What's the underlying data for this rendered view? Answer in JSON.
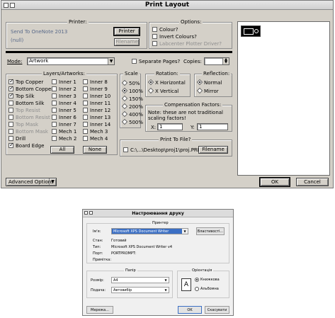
{
  "print_layout": {
    "title": "Print Layout",
    "printer": {
      "group_label": "Printer:",
      "name": "Send To OneNote 2013",
      "port": "(null)",
      "printer_button": "Printer",
      "filename_button": "Filename"
    },
    "options": {
      "group_label": "Options:",
      "colour": "Colour?",
      "invert": "Invert Colours?",
      "labcenter": "Labcenter Plotter Driver?"
    },
    "mode": {
      "label": "Mode:",
      "value": "Artwork",
      "separate_pages": "Separate Pages?",
      "copies_label": "Copies:"
    },
    "layers": {
      "group_label": "Layers/Artworks:",
      "col1": [
        {
          "label": "Top Copper",
          "checked": true,
          "disabled": false
        },
        {
          "label": "Bottom Copper",
          "checked": true,
          "disabled": false
        },
        {
          "label": "Top Silk",
          "checked": true,
          "disabled": false
        },
        {
          "label": "Bottom Silk",
          "checked": false,
          "disabled": false
        },
        {
          "label": "Top Resist",
          "checked": false,
          "disabled": true
        },
        {
          "label": "Bottom Resist",
          "checked": false,
          "disabled": true
        },
        {
          "label": "Top Mask",
          "checked": false,
          "disabled": true
        },
        {
          "label": "Bottom Mask",
          "checked": false,
          "disabled": true
        },
        {
          "label": "Drill",
          "checked": false,
          "disabled": false
        },
        {
          "label": "Board Edge",
          "checked": true,
          "disabled": false
        }
      ],
      "col2": [
        "Inner 1",
        "Inner 2",
        "Inner 3",
        "Inner 4",
        "Inner 5",
        "Inner 6",
        "Inner 7",
        "Mech 1",
        "Mech 2"
      ],
      "col3": [
        "Inner 8",
        "Inner 9",
        "Inner 10",
        "Inner 11",
        "Inner 12",
        "Inner 13",
        "Inner 14",
        "Mech 3",
        "Mech 4"
      ],
      "all_button": "All",
      "none_button": "None"
    },
    "scale": {
      "group_label": "Scale",
      "options": [
        "50%",
        "100%",
        "150%",
        "200%",
        "400%",
        "500%"
      ],
      "selected": "100%"
    },
    "rotation": {
      "group_label": "Rotation:",
      "options": [
        "X Horizontal",
        "X Vertical"
      ],
      "selected": "X Horizontal"
    },
    "reflection": {
      "group_label": "Reflection:",
      "options": [
        "Normal",
        "Mirror"
      ],
      "selected": "Normal"
    },
    "compensation": {
      "group_label": "Compensation Factors:",
      "note": "Note: these are not traditional scaling factors!",
      "x_label": "X:",
      "x_value": "1",
      "y_label": "Y:",
      "y_value": "1"
    },
    "print_to_file": {
      "group_label": "Print To File?",
      "path": "C:\\...\\Desktop\\proj1\\proj.PRN",
      "filename_button": "Filename"
    },
    "advanced_button": "Advanced Options",
    "ok_button": "OK",
    "cancel_button": "Cancel"
  },
  "print_setup": {
    "title": "Настроювання друку",
    "printer_group": "Принтер",
    "name_label": "Ім'я:",
    "name_value": "Microsoft XPS Document Writer",
    "properties_button": "Властивості...",
    "status_label": "Стан:",
    "status_value": "Готовий",
    "type_label": "Тип:",
    "type_value": "Microsoft XPS Document Writer v4",
    "port_label": "Порт:",
    "port_value": "PORTPROMPT:",
    "comment_label": "Примітка:",
    "paper_group": "Папір",
    "size_label": "Розмір:",
    "size_value": "A4",
    "source_label": "Подача:",
    "source_value": "Автовибір",
    "orientation_group": "Орієнтація",
    "portrait": "Книжкова",
    "landscape": "Альбомна",
    "orientation_selected": "Книжкова",
    "network_button": "Мережа...",
    "ok_button": "OK",
    "cancel_button": "Скасувати"
  }
}
